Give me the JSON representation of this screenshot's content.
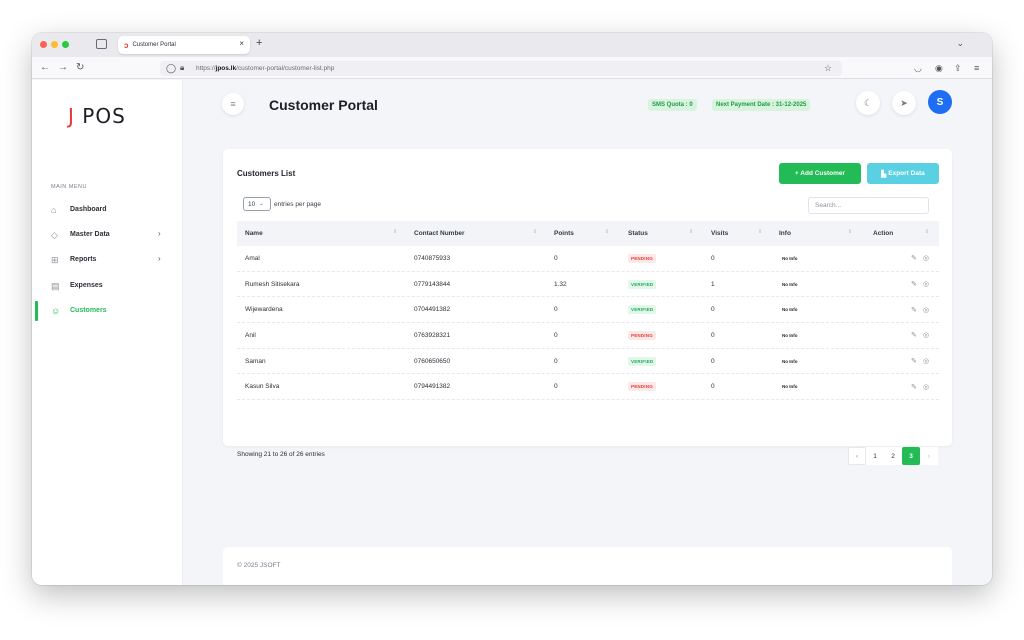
{
  "browser": {
    "tab_title": "Customer Portal",
    "tab_close": "×",
    "new_tab": "+",
    "url_prefix": "https://",
    "url_host": "jpos.lk",
    "url_path": "/customer-portal/customer-list.php"
  },
  "sidebar": {
    "logo_j": "J",
    "logo_text": "POS",
    "menu_title": "MAIN MENU",
    "items": [
      {
        "label": "Dashboard",
        "icon": "home-icon",
        "has_submenu": false,
        "active": false
      },
      {
        "label": "Master Data",
        "icon": "database-icon",
        "has_submenu": true,
        "active": false
      },
      {
        "label": "Reports",
        "icon": "grid-icon",
        "has_submenu": true,
        "active": false
      },
      {
        "label": "Expenses",
        "icon": "receipt-icon",
        "has_submenu": false,
        "active": false
      },
      {
        "label": "Customers",
        "icon": "user-icon",
        "has_submenu": false,
        "active": true
      }
    ]
  },
  "header": {
    "title": "Customer Portal",
    "sms_quota": "SMS Quota : 0",
    "next_payment": "Next Payment Date : 31-12-2025",
    "avatar_initial": "S"
  },
  "card": {
    "title": "Customers List",
    "add_button": "+ Add Customer",
    "export_button": "Export Data",
    "entries_value": "10",
    "entries_label": "entries per page",
    "search_placeholder": "Search...",
    "columns": [
      "Name",
      "Contact Number",
      "Points",
      "Status",
      "Visits",
      "Info",
      "Action"
    ],
    "rows": [
      {
        "name": "Amal",
        "contact": "0740875933",
        "points": "0",
        "status": "PENDING",
        "visits": "0",
        "info": "No Info"
      },
      {
        "name": "Rumesh Sitisekara",
        "contact": "0779143844",
        "points": "1.32",
        "status": "VERIFIED",
        "visits": "1",
        "info": "No Info"
      },
      {
        "name": "Wijewardena",
        "contact": "0704491382",
        "points": "0",
        "status": "VERIFIED",
        "visits": "0",
        "info": "No Info"
      },
      {
        "name": "Anil",
        "contact": "0763928321",
        "points": "0",
        "status": "PENDING",
        "visits": "0",
        "info": "No Info"
      },
      {
        "name": "Saman",
        "contact": "0760650650",
        "points": "0",
        "status": "VERIFIED",
        "visits": "0",
        "info": "No Info"
      },
      {
        "name": "Kasun Silva",
        "contact": "0794491382",
        "points": "0",
        "status": "PENDING",
        "visits": "0",
        "info": "No Info"
      }
    ],
    "showing": "Showing 21 to 26 of 26 entries",
    "pages": [
      "1",
      "2",
      "3"
    ],
    "active_page": "3",
    "prev": "‹",
    "next": "›"
  },
  "footer": {
    "text": "© 2025 JSOFT"
  },
  "colors": {
    "accent": "#22bb55",
    "export": "#5ad1e2",
    "pending": "#e53935",
    "avatar": "#1e6ef4"
  }
}
